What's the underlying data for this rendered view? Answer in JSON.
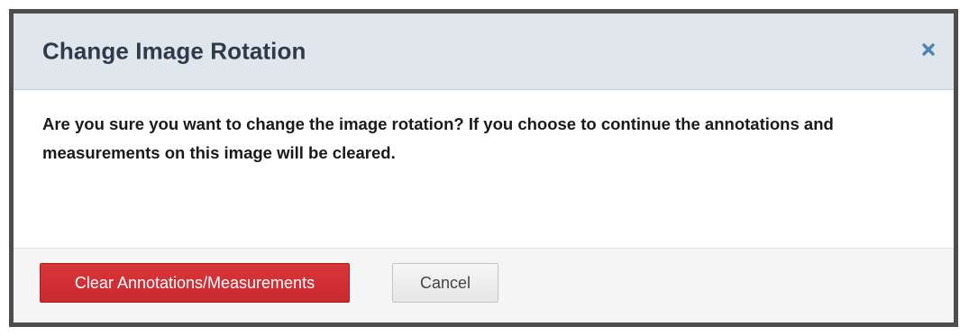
{
  "dialog": {
    "title": "Change Image Rotation",
    "message": "Are you sure you want to change the image rotation? If you choose to continue the annotations and measurements on this image will be cleared.",
    "close_icon": "close-icon",
    "buttons": {
      "confirm_label": "Clear Annotations/Measurements",
      "cancel_label": "Cancel"
    }
  },
  "colors": {
    "header_bg": "#dfe6ec",
    "title": "#2e3b4a",
    "close_icon": "#4a86b8",
    "primary_button": "#d9363a",
    "footer_bg": "#f5f5f5"
  }
}
